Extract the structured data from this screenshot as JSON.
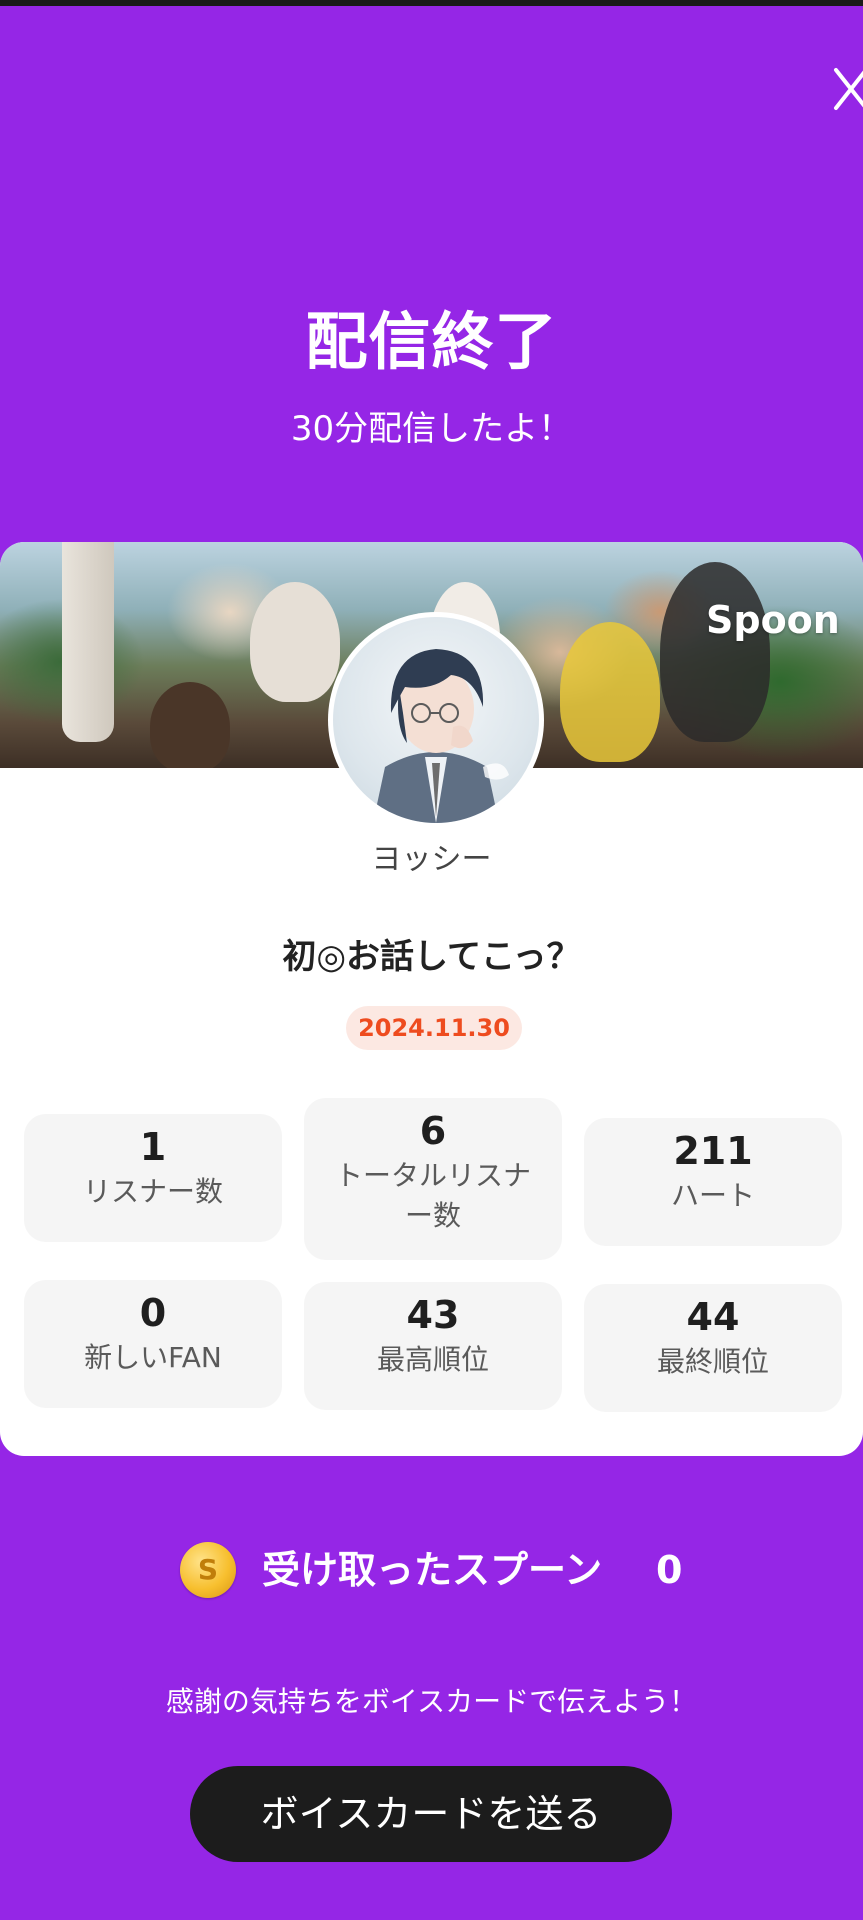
{
  "header": {
    "close_icon": "close-icon",
    "title": "配信終了",
    "subtitle": "30分配信したよ！"
  },
  "card": {
    "brand_logo": "Spoon",
    "username": "ヨッシー",
    "broadcast_title": "初◎お話してこっ？",
    "date": "2024.11.30",
    "stats": [
      {
        "value": "1",
        "label": "リスナー数"
      },
      {
        "value": "6",
        "label": "トータルリスナー数"
      },
      {
        "value": "211",
        "label": "ハート"
      },
      {
        "value": "0",
        "label": "新しいFAN"
      },
      {
        "value": "43",
        "label": "最高順位"
      },
      {
        "value": "44",
        "label": "最終順位"
      }
    ]
  },
  "spoons": {
    "coin_letter": "S",
    "label": "受け取ったスプーン",
    "count": "0"
  },
  "footer": {
    "message": "感謝の気持ちをボイスカードで伝えよう！",
    "button_label": "ボイスカードを送る"
  },
  "colors": {
    "background": "#9526E6",
    "date_badge_text": "#EE4C1F",
    "date_badge_bg": "#FCE8E2",
    "button_bg": "#1C1C1C"
  }
}
